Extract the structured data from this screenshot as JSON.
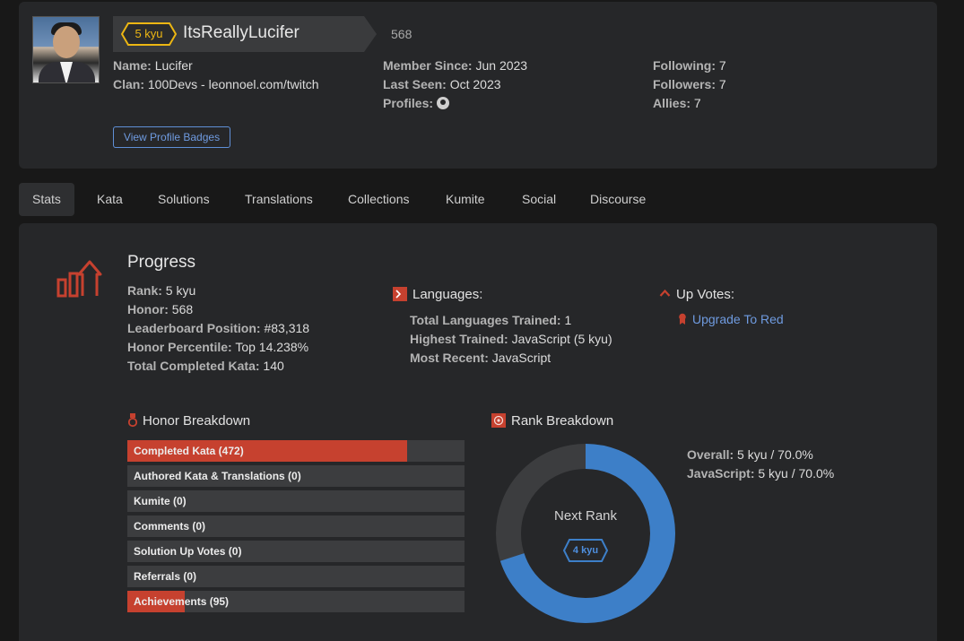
{
  "profile": {
    "kyu": "5 kyu",
    "username": "ItsReallyLucifer",
    "honor": "568",
    "name_label": "Name:",
    "name": "Lucifer",
    "clan_label": "Clan:",
    "clan": "100Devs - leonnoel.com/twitch",
    "member_since_label": "Member Since:",
    "member_since": "Jun 2023",
    "last_seen_label": "Last Seen:",
    "last_seen": "Oct 2023",
    "profiles_label": "Profiles:",
    "following_label": "Following:",
    "following": "7",
    "followers_label": "Followers:",
    "followers": "7",
    "allies_label": "Allies:",
    "allies": "7",
    "badges_button": "View Profile Badges"
  },
  "tabs": [
    "Stats",
    "Kata",
    "Solutions",
    "Translations",
    "Collections",
    "Kumite",
    "Social",
    "Discourse"
  ],
  "progress": {
    "title": "Progress",
    "rank_label": "Rank:",
    "rank": "5 kyu",
    "honor_label": "Honor:",
    "honor": "568",
    "leaderboard_label": "Leaderboard Position:",
    "leaderboard": "#83,318",
    "percentile_label": "Honor Percentile:",
    "percentile": "Top 14.238%",
    "completed_label": "Total Completed Kata:",
    "completed": "140"
  },
  "languages": {
    "title": "Languages:",
    "trained_label": "Total Languages Trained:",
    "trained": "1",
    "highest_label": "Highest Trained:",
    "highest": "JavaScript (5 kyu)",
    "recent_label": "Most Recent:",
    "recent": "JavaScript"
  },
  "upvotes": {
    "title": "Up Votes:",
    "link": "Upgrade To Red"
  },
  "honor_breakdown": {
    "title": "Honor Breakdown",
    "items": [
      {
        "label": "Completed Kata (472)",
        "fraction": 0.83
      },
      {
        "label": "Authored Kata & Translations (0)",
        "fraction": 0
      },
      {
        "label": "Kumite (0)",
        "fraction": 0
      },
      {
        "label": "Comments (0)",
        "fraction": 0
      },
      {
        "label": "Solution Up Votes (0)",
        "fraction": 0
      },
      {
        "label": "Referrals (0)",
        "fraction": 0
      },
      {
        "label": "Achievements (95)",
        "fraction": 0.17
      }
    ]
  },
  "rank_breakdown": {
    "title": "Rank Breakdown",
    "overall_label": "Overall:",
    "overall": "5 kyu / 70.0%",
    "js_label": "JavaScript:",
    "js": "5 kyu / 70.0%",
    "next_rank_label": "Next Rank",
    "next_rank": "4 kyu",
    "progress_fraction": 0.7
  },
  "colors": {
    "accent_red": "#c6412f",
    "accent_blue": "#3d7fc8",
    "kyu_yellow": "#ecb613",
    "link_blue": "#6f9be0"
  }
}
